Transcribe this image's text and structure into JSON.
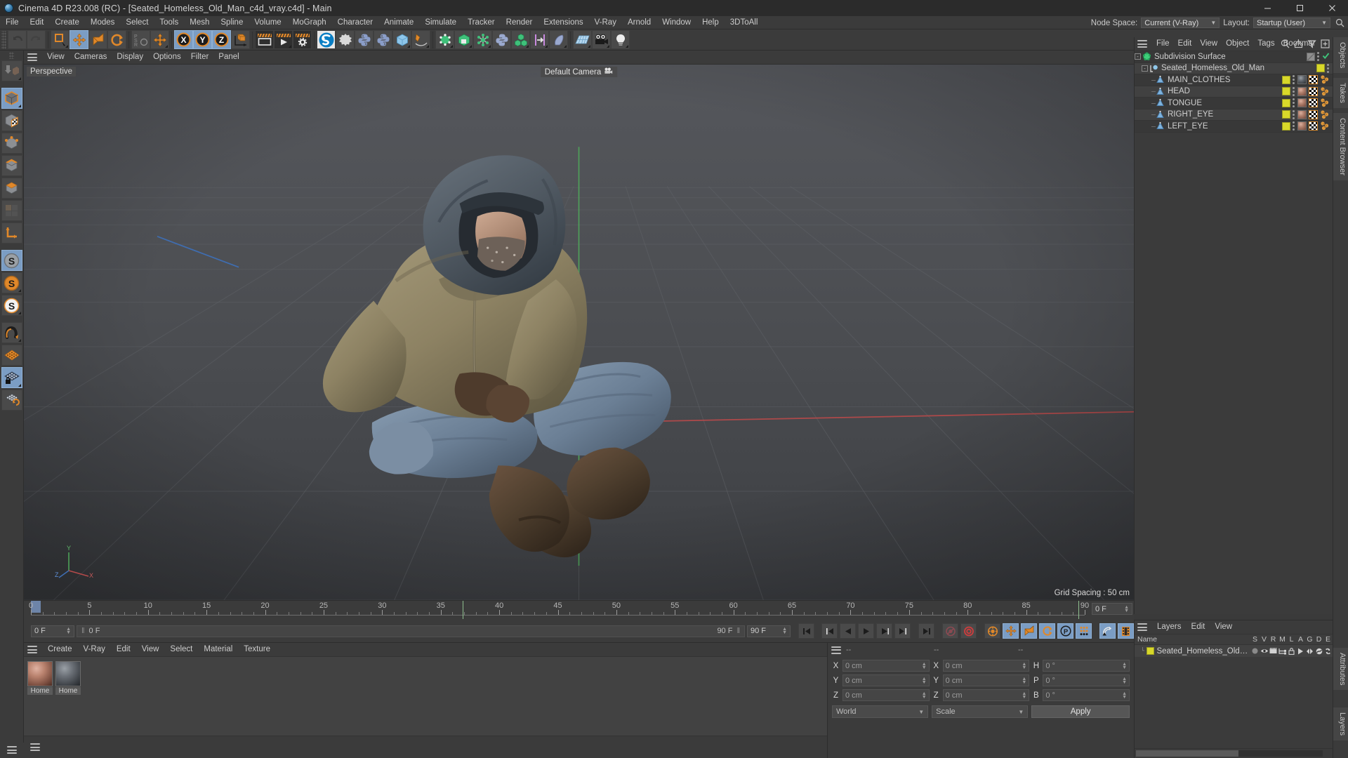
{
  "titlebar": {
    "title": "Cinema 4D R23.008 (RC) - [Seated_Homeless_Old_Man_c4d_vray.c4d] - Main",
    "minimize": "minimize-icon",
    "maximize": "maximize-icon",
    "close": "close-icon"
  },
  "menubar": {
    "items": [
      "File",
      "Edit",
      "Create",
      "Modes",
      "Select",
      "Tools",
      "Mesh",
      "Spline",
      "Volume",
      "MoGraph",
      "Character",
      "Animate",
      "Simulate",
      "Tracker",
      "Render",
      "Extensions",
      "V-Ray",
      "Arnold",
      "Window",
      "Help",
      "3DToAll"
    ],
    "node_space_label": "Node Space:",
    "node_space_value": "Current (V-Ray)",
    "layout_label": "Layout:",
    "layout_value": "Startup (User)",
    "search_icon": "search-icon"
  },
  "toolbar": {
    "groups": [
      {
        "tools": [
          {
            "name": "undo-tool",
            "icon": "undo",
            "state": "normal"
          },
          {
            "name": "redo-tool",
            "icon": "redo",
            "state": "disabled"
          }
        ]
      },
      {
        "tools": [
          {
            "name": "live-selection-tool",
            "icon": "select",
            "state": "normal",
            "corner": true
          },
          {
            "name": "move-tool",
            "icon": "move",
            "state": "selected"
          },
          {
            "name": "scale-tool",
            "icon": "scale",
            "state": "normal"
          },
          {
            "name": "rotate-tool",
            "icon": "rotate",
            "state": "normal"
          }
        ]
      },
      {
        "tools": [
          {
            "name": "psr-tool",
            "icon": "psr",
            "state": "normal"
          },
          {
            "name": "move-axis-tool",
            "icon": "move",
            "state": "normal",
            "corner": true
          }
        ]
      },
      {
        "tools": [
          {
            "name": "lock-x-axis",
            "icon": "X",
            "state": "selected"
          },
          {
            "name": "lock-y-axis",
            "icon": "Y",
            "state": "selected"
          },
          {
            "name": "lock-z-axis",
            "icon": "Z",
            "state": "selected"
          },
          {
            "name": "world-object-axis",
            "icon": "axis-cube",
            "state": "normal"
          }
        ]
      },
      {
        "tools": [
          {
            "name": "render-view-tool",
            "icon": "render-view",
            "state": "dark"
          },
          {
            "name": "render-to-picture-viewer-tool",
            "icon": "render-picture",
            "state": "dark",
            "corner": true
          },
          {
            "name": "render-settings-tool",
            "icon": "render-settings",
            "state": "dark"
          }
        ]
      },
      {
        "tools": [
          {
            "name": "substance-tool",
            "icon": "substance",
            "state": "white"
          },
          {
            "name": "cineware-tool",
            "icon": "gear-star",
            "state": "normal"
          },
          {
            "name": "python-generator-tool",
            "icon": "python",
            "state": "normal"
          },
          {
            "name": "python-tag-tool",
            "icon": "python",
            "state": "normal"
          },
          {
            "name": "cube-primitive-tool",
            "icon": "cube-blue",
            "state": "normal",
            "corner": true
          },
          {
            "name": "spline-pen-tool",
            "icon": "pen",
            "state": "normal",
            "corner": true
          }
        ]
      },
      {
        "tools": [
          {
            "name": "nurbs-tool",
            "icon": "green-cube-points",
            "state": "normal",
            "corner": true
          },
          {
            "name": "array-tool",
            "icon": "green-cube",
            "state": "normal",
            "corner": true
          },
          {
            "name": "cloner-tool",
            "icon": "molecule-green",
            "state": "normal",
            "corner": true
          },
          {
            "name": "python-effector-tool",
            "icon": "python",
            "state": "normal"
          },
          {
            "name": "mograph-tool",
            "icon": "three-cubes",
            "state": "normal",
            "corner": true
          },
          {
            "name": "deformer-tool",
            "icon": "bend",
            "state": "normal",
            "corner": true
          },
          {
            "name": "bend-tool",
            "icon": "bend-shape",
            "state": "normal",
            "corner": true
          }
        ]
      },
      {
        "tools": [
          {
            "name": "floor-tool",
            "icon": "floor-grid",
            "state": "normal",
            "corner": true
          },
          {
            "name": "camera-tool",
            "icon": "camera",
            "state": "normal",
            "corner": true
          },
          {
            "name": "light-tool",
            "icon": "light-bulb",
            "state": "normal",
            "corner": true
          }
        ]
      }
    ]
  },
  "left_palette": {
    "tools": [
      {
        "name": "make-editable-tool",
        "icon": "make-editable",
        "state": "disabled",
        "corner": true
      },
      {
        "name": "model-mode-tool",
        "icon": "model-cube",
        "state": "selected",
        "corner": true
      },
      {
        "name": "texture-mode-tool",
        "icon": "texture-cube",
        "state": "normal"
      },
      {
        "name": "points-mode-tool",
        "icon": "points-cube",
        "state": "normal"
      },
      {
        "name": "edges-mode-tool",
        "icon": "edges-cube",
        "state": "normal"
      },
      {
        "name": "polygons-mode-tool",
        "icon": "polygon-cube",
        "state": "normal"
      },
      {
        "name": "uv-mode-tool",
        "icon": "uv-grid",
        "state": "disabled"
      },
      {
        "name": "axis-mode-tool",
        "icon": "axis-angle",
        "state": "normal"
      },
      {
        "name": "enable-axis-tool",
        "icon": "s-grey",
        "state": "selected"
      },
      {
        "name": "world-axis-tool",
        "icon": "s-orange",
        "state": "normal",
        "corner": true
      },
      {
        "name": "object-axis-tool",
        "icon": "s-white",
        "state": "normal",
        "corner": true
      },
      {
        "name": "snap-tool",
        "icon": "magnet",
        "state": "normal",
        "corner": true
      },
      {
        "name": "workplane-tool",
        "icon": "workplane",
        "state": "normal"
      },
      {
        "name": "lock-workplane-tool",
        "icon": "workplane-lock",
        "state": "selected",
        "corner": true
      },
      {
        "name": "planar-workplane-tool",
        "icon": "workplane-rotate",
        "state": "normal"
      }
    ]
  },
  "viewport": {
    "menu": [
      "View",
      "Cameras",
      "Display",
      "Options",
      "Filter",
      "Panel"
    ],
    "view_label": "Perspective",
    "camera_label": "Default Camera",
    "camera_icon": "camera-icon",
    "grid_spacing": "Grid Spacing : 50 cm",
    "axis": {
      "x": "X",
      "y": "Y",
      "z": "Z"
    }
  },
  "timeline": {
    "ticks": [
      0,
      5,
      10,
      15,
      20,
      25,
      30,
      35,
      40,
      45,
      50,
      55,
      60,
      65,
      70,
      75,
      80,
      85,
      90
    ],
    "min_frame": 0,
    "max_frame": 90,
    "end_field": "0 F",
    "current_frame_field": "0 F",
    "current_frame_track": "0 F",
    "range_end_track": "90 F",
    "range_end_field": "90 F",
    "transport": [
      {
        "name": "go-to-start-button",
        "icon": "skip-start"
      },
      {
        "name": "go-to-previous-key-button",
        "icon": "prev-key"
      },
      {
        "name": "go-to-previous-frame-button",
        "icon": "prev-frame"
      },
      {
        "name": "play-button",
        "icon": "play"
      },
      {
        "name": "go-to-next-frame-button",
        "icon": "next-frame"
      },
      {
        "name": "go-to-next-key-button",
        "icon": "next-key"
      },
      {
        "name": "go-to-end-button",
        "icon": "skip-end"
      },
      {
        "name": "record-active-objects-button",
        "icon": "record"
      },
      {
        "name": "autokeying-button",
        "icon": "autokey"
      },
      {
        "name": "keyframe-selection-button",
        "icon": "key-select"
      },
      {
        "name": "position-key-button",
        "icon": "position"
      },
      {
        "name": "scale-key-button",
        "icon": "scale"
      },
      {
        "name": "rotation-key-button",
        "icon": "rotation"
      },
      {
        "name": "parameter-key-button",
        "icon": "param"
      },
      {
        "name": "point-level-animation-button",
        "icon": "pla-dots"
      },
      {
        "name": "dynamics-button",
        "icon": "dynamics"
      },
      {
        "name": "timeline-button",
        "icon": "filmstrip"
      }
    ]
  },
  "material_manager": {
    "menu": [
      "Create",
      "V-Ray",
      "Edit",
      "View",
      "Select",
      "Material",
      "Texture"
    ],
    "materials": [
      {
        "name": "Home",
        "swatch": "skin"
      },
      {
        "name": "Home",
        "swatch": "dark"
      }
    ]
  },
  "coordinates": {
    "headers": [
      "--",
      "--",
      "--"
    ],
    "rows": [
      {
        "left_label": "X",
        "left_value": "0 cm",
        "mid_label": "X",
        "mid_value": "0 cm",
        "right_label": "H",
        "right_value": "0 °"
      },
      {
        "left_label": "Y",
        "left_value": "0 cm",
        "mid_label": "Y",
        "mid_value": "0 cm",
        "right_label": "P",
        "right_value": "0 °"
      },
      {
        "left_label": "Z",
        "left_value": "0 cm",
        "mid_label": "Z",
        "mid_value": "0 cm",
        "right_label": "B",
        "right_value": "0 °"
      }
    ],
    "system": "World",
    "mode": "Scale",
    "apply_label": "Apply"
  },
  "object_manager": {
    "menu": [
      "File",
      "Edit",
      "View",
      "Object",
      "Tags",
      "Bookmar"
    ],
    "icons": [
      "search-icon",
      "home-icon",
      "filter-icon",
      "add-icon"
    ],
    "rows": [
      {
        "name": "Subdivision Surface",
        "depth": 0,
        "icon": "subdivision-surface-icon",
        "expander": "-",
        "tags": [
          {
            "type": "swatch-grey"
          },
          {
            "type": "dots"
          },
          {
            "type": "check"
          }
        ]
      },
      {
        "name": "Seated_Homeless_Old_Man",
        "depth": 1,
        "icon": "null-object-icon",
        "expander": "-",
        "tags": [
          {
            "type": "swatch-yellow"
          },
          {
            "type": "dots"
          }
        ]
      },
      {
        "name": "MAIN_CLOTHES",
        "depth": 2,
        "icon": "polygon-object-icon",
        "expander": "",
        "tags": [
          {
            "type": "swatch-yellow"
          },
          {
            "type": "dots"
          },
          {
            "type": "texture-dark"
          },
          {
            "type": "checker"
          },
          {
            "type": "molecule"
          }
        ]
      },
      {
        "name": "HEAD",
        "depth": 2,
        "icon": "polygon-object-icon",
        "expander": "",
        "tags": [
          {
            "type": "swatch-yellow"
          },
          {
            "type": "dots"
          },
          {
            "type": "texture-skin"
          },
          {
            "type": "checker"
          },
          {
            "type": "molecule"
          }
        ]
      },
      {
        "name": "TONGUE",
        "depth": 2,
        "icon": "polygon-object-icon",
        "expander": "",
        "tags": [
          {
            "type": "swatch-yellow"
          },
          {
            "type": "dots"
          },
          {
            "type": "texture-skin"
          },
          {
            "type": "checker"
          },
          {
            "type": "molecule"
          }
        ]
      },
      {
        "name": "RIGHT_EYE",
        "depth": 2,
        "icon": "polygon-object-icon",
        "expander": "",
        "tags": [
          {
            "type": "swatch-yellow"
          },
          {
            "type": "dots"
          },
          {
            "type": "texture-skin"
          },
          {
            "type": "checker"
          },
          {
            "type": "molecule"
          }
        ]
      },
      {
        "name": "LEFT_EYE",
        "depth": 2,
        "icon": "polygon-object-icon",
        "expander": "",
        "tags": [
          {
            "type": "swatch-yellow"
          },
          {
            "type": "dots"
          },
          {
            "type": "texture-skin"
          },
          {
            "type": "checker"
          },
          {
            "type": "molecule"
          }
        ]
      }
    ]
  },
  "right_tabs": [
    "Objects",
    "Takes",
    "Content Browser"
  ],
  "right_tabs_bottom": [
    "Attributes",
    "Layers"
  ],
  "layers_panel": {
    "menu": [
      "Layers",
      "Edit",
      "View"
    ],
    "columns": [
      "Name",
      "S",
      "V",
      "R",
      "M",
      "L",
      "A",
      "G",
      "D",
      "E"
    ],
    "rows": [
      {
        "name": "Seated_Homeless_Old_Man",
        "color": "#d8d82a"
      }
    ]
  },
  "colors": {
    "panel_bg": "#3b3b3b",
    "viewport_bg": "#4a4c50",
    "accent_blue": "#7b9dc4",
    "accent_orange": "#e08a2b",
    "layer_yellow": "#d8d82a",
    "text": "#c8c8c8"
  }
}
